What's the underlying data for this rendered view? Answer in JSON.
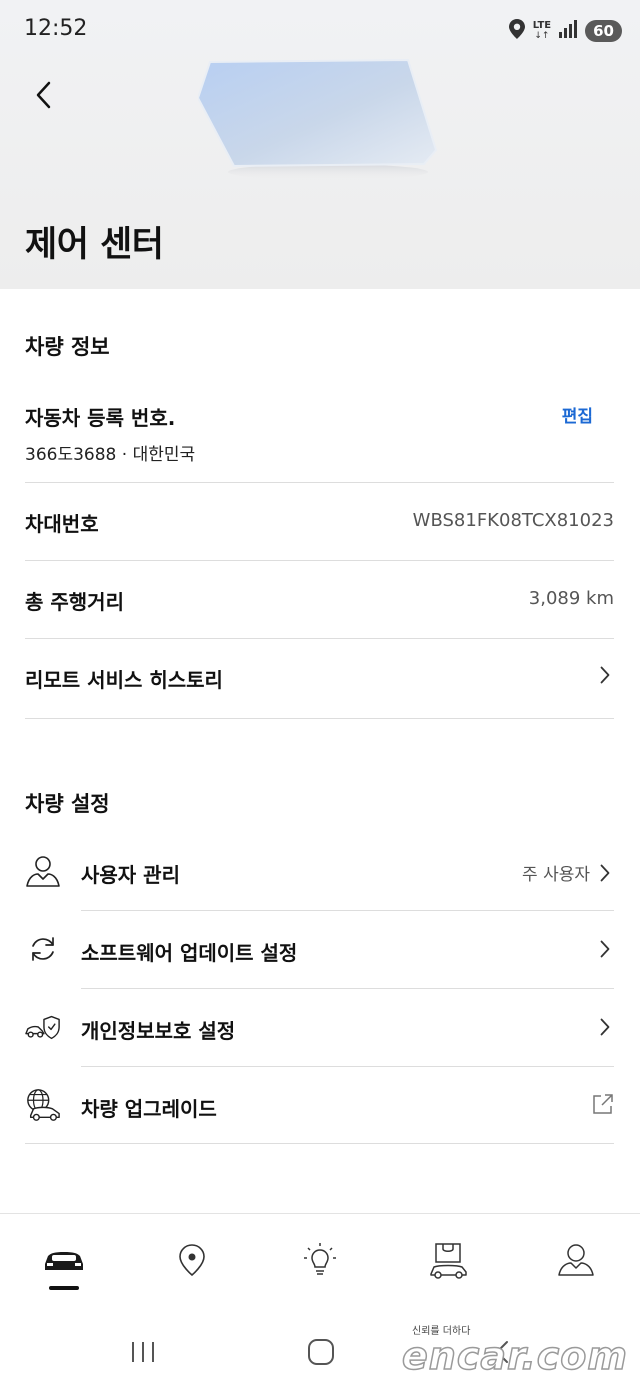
{
  "status_bar": {
    "time": "12:52",
    "network": "LTE",
    "battery": "60"
  },
  "header": {
    "title": "제어 센터"
  },
  "vehicle_info": {
    "section_title": "차량 정보",
    "registration": {
      "label": "자동차 등록 번호.",
      "edit_label": "편집",
      "value": "366도3688 · 대한민국"
    },
    "vin": {
      "label": "차대번호",
      "value": "WBS81FK08TCX81023"
    },
    "mileage": {
      "label": "총 주행거리",
      "value": "3,089 km"
    },
    "remote_history": {
      "label": "리모트 서비스 히스토리"
    }
  },
  "vehicle_settings": {
    "section_title": "차량 설정",
    "items": [
      {
        "label": "사용자 관리",
        "value": "주 사용자",
        "icon": "user-icon",
        "action": "chevron"
      },
      {
        "label": "소프트웨어 업데이트 설정",
        "value": "",
        "icon": "refresh-icon",
        "action": "chevron"
      },
      {
        "label": "개인정보보호 설정",
        "value": "",
        "icon": "car-shield-icon",
        "action": "chevron"
      },
      {
        "label": "차량 업그레이드",
        "value": "",
        "icon": "globe-car-icon",
        "action": "external-link"
      }
    ]
  },
  "bottom_nav": {
    "items": [
      {
        "icon": "car-icon",
        "active": true
      },
      {
        "icon": "map-pin-icon",
        "active": false
      },
      {
        "icon": "lightbulb-icon",
        "active": false
      },
      {
        "icon": "shop-car-icon",
        "active": false
      },
      {
        "icon": "profile-icon",
        "active": false
      }
    ]
  },
  "watermark": {
    "tagline": "신뢰를 더하다",
    "brand": "encar.com"
  },
  "colors": {
    "accent": "#1c69d4",
    "header_bg": "#efefef",
    "divider": "#dddddd"
  }
}
